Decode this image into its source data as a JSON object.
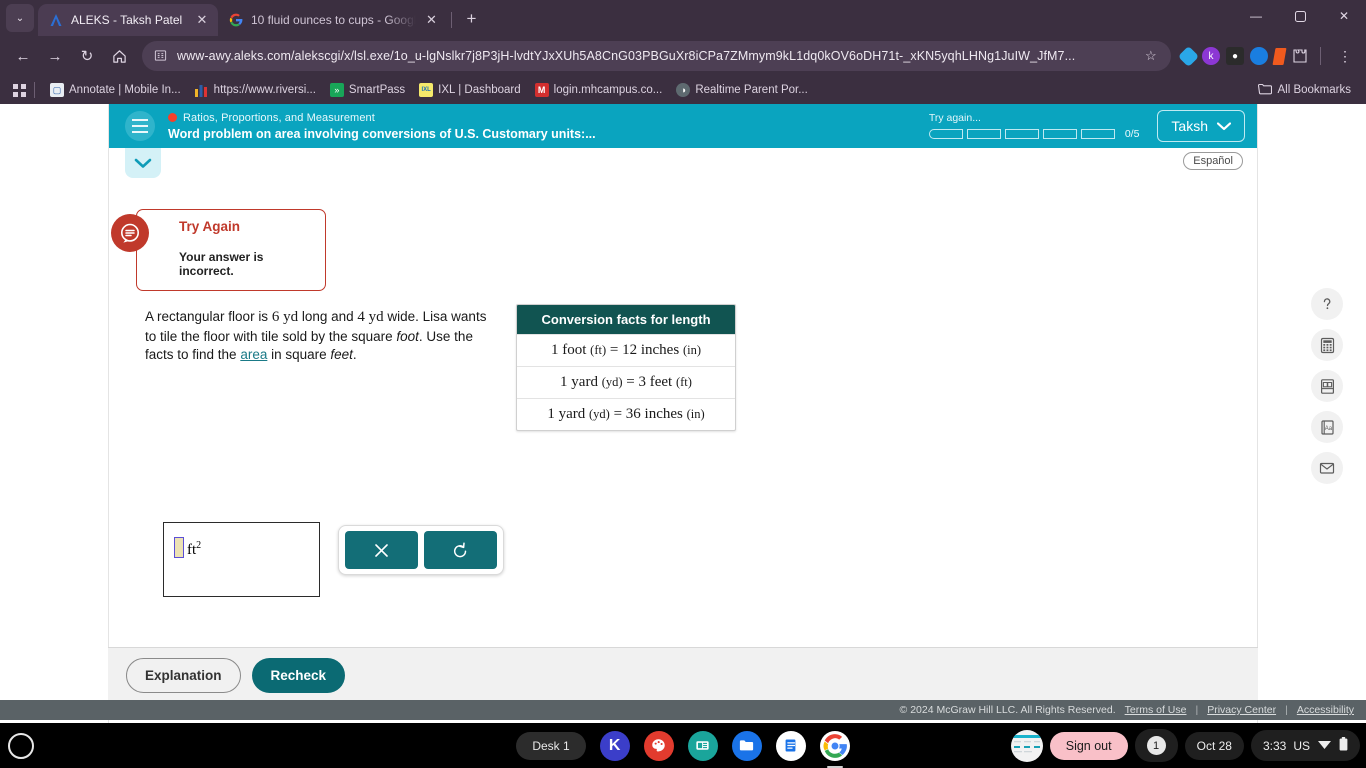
{
  "browser": {
    "tabs": [
      {
        "title": "ALEKS - Taksh Patel",
        "favicon": "aleks-icon",
        "active": true
      },
      {
        "title": "10 fluid ounces to cups - Googl",
        "favicon": "google-icon",
        "active": false
      }
    ],
    "new_tab_label": "+",
    "tab_search_label": "⌄",
    "window_controls": {
      "minimize": "—",
      "maximize": "❐",
      "close": "✕"
    },
    "nav": {
      "back": "←",
      "forward": "→",
      "reload": "↻",
      "home": "⌂"
    },
    "omnibox": {
      "url": "www-awy.aleks.com/alekscgi/x/lsl.exe/1o_u-lgNslkr7j8P3jH-lvdtYJxXUh5A8CnG03PBGuXr8iCPa7ZMmym9kL1dq0kOV6oDH71t-_xKN5yqhLHNg1JuIW_JfM7...",
      "placeholder": "Search Google or type a URL",
      "star": "☆"
    },
    "extensions": [
      {
        "name": "diamond-extension-icon",
        "glyph": "◆",
        "color": "#2aa7e8"
      },
      {
        "name": "kami-extension-icon",
        "glyph": "k",
        "color": "#8c37d4"
      },
      {
        "name": "gorilla-extension-icon",
        "glyph": "●",
        "color": "#2b2b2b"
      },
      {
        "name": "pie-extension-icon",
        "glyph": "◔",
        "color": "#1a7ee0"
      },
      {
        "name": "orange-extension-icon",
        "glyph": "▰",
        "color": "#f05a1e"
      },
      {
        "name": "puzzle-extensions-icon",
        "glyph": "❖",
        "color": "#3b2f40"
      }
    ],
    "menu_label": "⋮",
    "bookmarks": {
      "apps_label": "☷",
      "items": [
        {
          "label": "Annotate | Mobile In...",
          "icon_glyph": "◧",
          "icon_color": "#e8ecf2"
        },
        {
          "label": "https://www.riversi...",
          "icon_glyph": "█",
          "icon_color": "#f0b429"
        },
        {
          "label": "SmartPass",
          "icon_glyph": "»",
          "icon_color": "#18a558"
        },
        {
          "label": "IXL | Dashboard",
          "icon_glyph": "IXL",
          "icon_color": "#f5e96b"
        },
        {
          "label": "login.mhcampus.co...",
          "icon_glyph": "M",
          "icon_color": "#d32f2f"
        },
        {
          "label": "Realtime Parent Por...",
          "icon_glyph": "◑",
          "icon_color": "#5e6a70"
        }
      ],
      "all_bookmarks_label": "All Bookmarks",
      "all_bookmarks_icon": "folder-icon"
    }
  },
  "aleks": {
    "header": {
      "menu_icon": "hamburger-icon",
      "category": "Ratios, Proportions, and Measurement",
      "status_dot_color": "#f4402a",
      "problem_title": "Word problem on area involving conversions of U.S. Customary units:...",
      "progress_label": "Try again...",
      "progress_segments": 5,
      "progress_filled": 0,
      "progress_count": "0/5",
      "user_name": "Taksh",
      "user_caret": "⌄",
      "accent_color": "#0aa4bf"
    },
    "subbar": {
      "collapse_icon": "chevron-down-icon",
      "espanol_label": "Español"
    },
    "callout": {
      "icon": "feedback-bubble-icon",
      "title": "Try Again",
      "body": "Your answer is incorrect.",
      "color": "#c0392b"
    },
    "problem": {
      "line1_a": "A rectangular floor is ",
      "num1": "6 yd",
      "line1_b": " long and ",
      "num2": "4 yd",
      "line1_c": " wide. Lisa wants to tile the floor with tile sold by the square ",
      "foot_italic": "foot",
      "line2_a": ". Use the facts to find the ",
      "area_link": "area",
      "line2_b": " in square ",
      "feet_italic": "feet",
      "line2_c": "."
    },
    "conversion_table": {
      "header": "Conversion facts for length",
      "rows": [
        {
          "left_qty": "1 foot",
          "left_unit": "(ft)",
          "eq": "=",
          "right_qty": "12 inches",
          "right_unit": "(in)"
        },
        {
          "left_qty": "1 yard",
          "left_unit": "(yd)",
          "eq": "=",
          "right_qty": "3 feet",
          "right_unit": "(ft)"
        },
        {
          "left_qty": "1 yard",
          "left_unit": "(yd)",
          "eq": "=",
          "right_qty": "36 inches",
          "right_unit": "(in)"
        }
      ],
      "header_color": "#115451"
    },
    "answer": {
      "value": "",
      "placeholder": "",
      "unit": "ft",
      "exponent": "2"
    },
    "tools": {
      "clear_icon": "clear-x-icon",
      "clear_label": "✕",
      "undo_icon": "undo-icon",
      "undo_label": "↺",
      "button_color": "#136e77"
    },
    "side_tools": [
      {
        "name": "help-icon",
        "glyph": "?"
      },
      {
        "name": "calculator-icon",
        "glyph": "▦"
      },
      {
        "name": "reference-book-icon",
        "glyph": "◫"
      },
      {
        "name": "dictionary-icon",
        "glyph": "Aa"
      },
      {
        "name": "mail-icon",
        "glyph": "✉"
      }
    ],
    "footer": {
      "explanation_label": "Explanation",
      "recheck_label": "Recheck",
      "recheck_color": "#0b6a73"
    },
    "copyright": {
      "text": "© 2024 McGraw Hill LLC. All Rights Reserved.",
      "links": [
        "Terms of Use",
        "Privacy Center",
        "Accessibility"
      ],
      "separator": "|"
    }
  },
  "shelf": {
    "launcher_icon": "launcher-circle-icon",
    "desk_label": "Desk 1",
    "apps": [
      {
        "name": "kami-app-icon",
        "glyph": "K",
        "color": "#3b3ec9",
        "active": false
      },
      {
        "name": "paint-app-icon",
        "glyph": "❀",
        "color": "#e23b2e",
        "active": false
      },
      {
        "name": "classroom-app-icon",
        "glyph": "▤",
        "color": "#1aa59b",
        "active": false
      },
      {
        "name": "files-app-icon",
        "glyph": "▰",
        "color": "#1a73e8",
        "active": false
      },
      {
        "name": "docs-app-icon",
        "glyph": "☰",
        "color": "#ffffff",
        "active": false
      },
      {
        "name": "chrome-app-icon",
        "glyph": "◉",
        "color": "#ffffff",
        "active": true
      }
    ],
    "window_preview_icon": "window-preview-icon",
    "sign_out_label": "Sign out",
    "notification_count": "1",
    "date": "Oct 28",
    "time": "3:33",
    "locale": "US",
    "wifi_icon": "wifi-icon",
    "battery_icon": "battery-icon"
  }
}
